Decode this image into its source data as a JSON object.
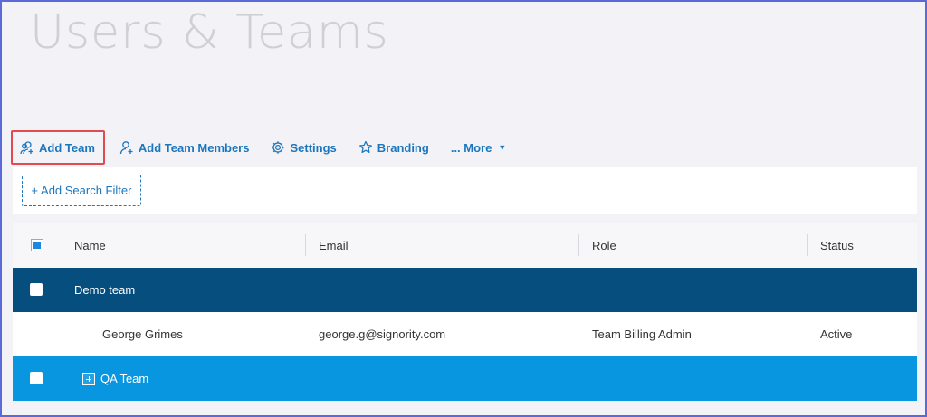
{
  "page": {
    "title": "Users & Teams"
  },
  "toolbar": {
    "add_team": "Add Team",
    "add_team_members": "Add Team Members",
    "settings": "Settings",
    "branding": "Branding",
    "more": "... More"
  },
  "filter": {
    "add_search_filter": "+ Add Search Filter"
  },
  "table": {
    "columns": {
      "name": "Name",
      "email": "Email",
      "role": "Role",
      "status": "Status"
    },
    "rows": [
      {
        "type": "team",
        "name": "Demo team"
      },
      {
        "type": "member",
        "name": "George Grimes",
        "email": "george.g@signority.com",
        "role": "Team Billing Admin",
        "status": "Active"
      },
      {
        "type": "team",
        "name": "QA Team"
      }
    ]
  },
  "colors": {
    "accent": "#1b76bd",
    "highlight": "#e04b4b",
    "team_row_dark": "#064e7e",
    "team_row_blue": "#0996e0"
  },
  "icons": {
    "add_team": "add-team-icon",
    "add_member": "add-user-icon",
    "settings": "gear-icon",
    "branding": "star-icon",
    "more_caret": "caret-down-icon"
  }
}
